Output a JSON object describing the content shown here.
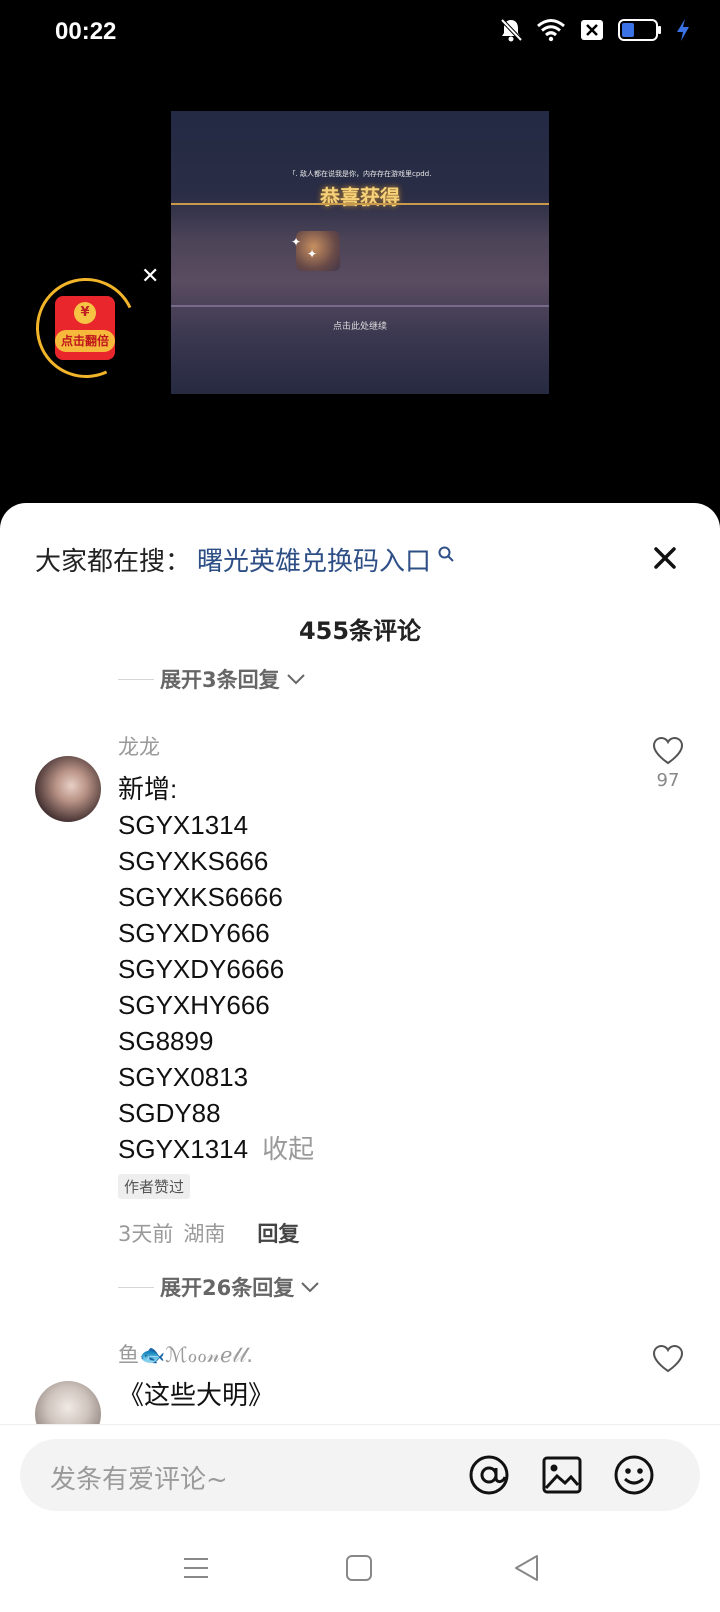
{
  "status_bar": {
    "time": "00:22",
    "icons": [
      "mute-bell-icon",
      "wifi-icon",
      "sim-off-icon",
      "battery-icon",
      "charging-icon"
    ]
  },
  "video": {
    "title": "恭喜获得",
    "subtitle": "「. 敌人都在说我是你，内存存在游戏里cpdd.",
    "continue_text": "点击此处继续"
  },
  "red_packet": {
    "coin": "¥",
    "label": "点击翻倍"
  },
  "sheet": {
    "search_prefix": "大家都在搜：",
    "search_link": "曙光英雄兑换码入口",
    "comments_count": "455条评论"
  },
  "top_expand": {
    "label": "展开3条回复"
  },
  "comments": [
    {
      "username": "龙龙",
      "lines": [
        "新增:",
        "SGYX1314",
        "SGYXKS666",
        "SGYXKS6666",
        "SGYXDY666",
        "SGYXDY6666",
        "SGYXHY666",
        "SG8899",
        "SGYX0813",
        "SGDY88",
        "SGYX1314"
      ],
      "collapse": "收起",
      "badge": "作者赞过",
      "time": "3天前",
      "location": "湖南",
      "reply": "回复",
      "likes": "97",
      "expand_label": "展开26条回复"
    },
    {
      "username": "鱼🐟ℳℴℴ𝓃ℯ𝓁𝓁.",
      "partial_text": "《这些大明》"
    }
  ],
  "input": {
    "placeholder": "发条有爱评论~"
  },
  "colors": {
    "link": "#2e4f86",
    "red_packet": "#e8262c",
    "gold": "#f2b52a"
  }
}
